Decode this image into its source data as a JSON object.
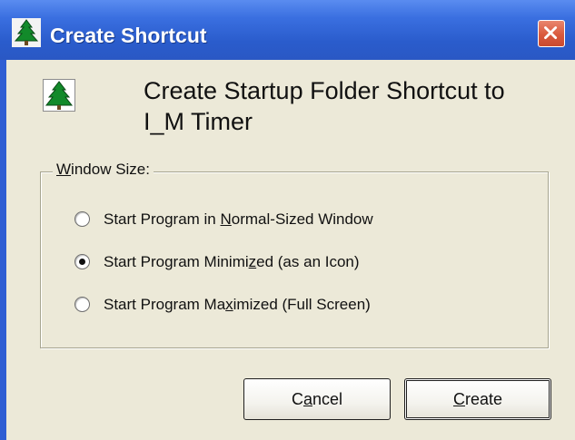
{
  "window": {
    "title": "Create Shortcut",
    "title_icon": "tree-icon",
    "close_icon": "close-icon",
    "titlebar_color": "#2a5ccc",
    "close_button_color": "#d9593d",
    "face_color": "#ece9d8"
  },
  "header": {
    "app_icon": "tree-icon",
    "title_line1": "Create Startup Folder Shortcut to",
    "title_line2": "I_M Timer"
  },
  "window_size_group": {
    "legend": {
      "mnemonic": "W",
      "rest": "indow Size:"
    },
    "selected_index": 1,
    "options": [
      {
        "before": "Start Program in ",
        "mnemonic": "N",
        "after": "ormal-Sized Window",
        "checked": false
      },
      {
        "before": "Start Program Minimi",
        "mnemonic": "z",
        "after": "ed (as an Icon)",
        "checked": true
      },
      {
        "before": "Start Program Ma",
        "mnemonic": "x",
        "after": "imized (Full Screen)",
        "checked": false
      }
    ]
  },
  "buttons": {
    "cancel": {
      "before": "C",
      "mnemonic": "a",
      "after": "ncel"
    },
    "create": {
      "before": "",
      "mnemonic": "C",
      "after": "reate"
    }
  }
}
